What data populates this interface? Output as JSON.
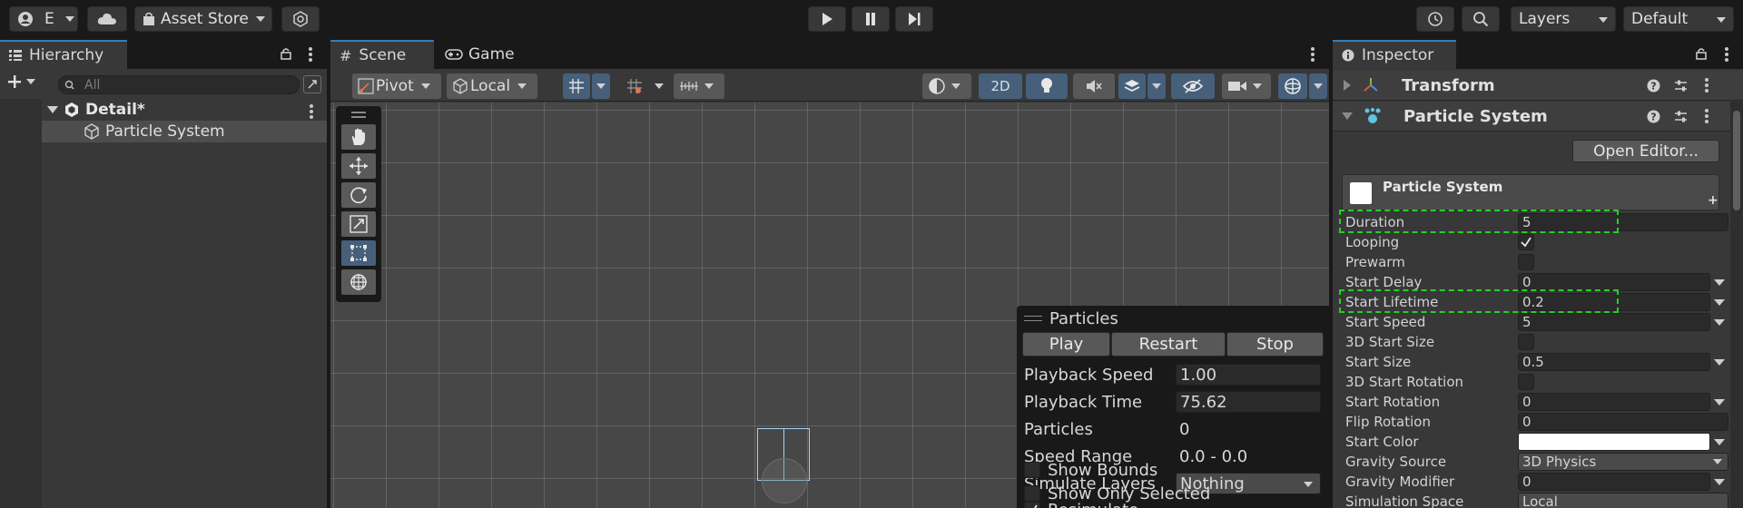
{
  "topbar": {
    "account_initial": "E",
    "asset_store": "Asset Store",
    "layers": "Layers",
    "layout": "Default"
  },
  "hierarchy": {
    "tab": "Hierarchy",
    "search_placeholder": "All",
    "scene_name": "Detail*",
    "items": [
      {
        "label": "Particle System"
      }
    ]
  },
  "scene": {
    "tabs": [
      {
        "label": "Scene"
      },
      {
        "label": "Game"
      }
    ],
    "toolbar": {
      "pivot": "Pivot",
      "local": "Local",
      "mode_2d": "2D"
    }
  },
  "particles_overlay": {
    "title": "Particles",
    "buttons": [
      "Play",
      "Restart",
      "Stop"
    ],
    "fields": [
      {
        "label": "Playback Speed",
        "value": "1.00"
      },
      {
        "label": "Playback Time",
        "value": "75.62"
      },
      {
        "label": "Particles",
        "value": "0"
      },
      {
        "label": "Speed Range",
        "value": "0.0 - 0.0"
      },
      {
        "label": "Simulate Layers",
        "value": "Nothing"
      }
    ],
    "toggles": [
      {
        "label": "Resimulate",
        "checked": true
      },
      {
        "label": "Show Bounds",
        "checked": false
      },
      {
        "label": "Show Only Selected",
        "checked": false
      }
    ]
  },
  "inspector": {
    "tab": "Inspector",
    "components": [
      {
        "name": "Transform"
      },
      {
        "name": "Particle System"
      }
    ],
    "open_editor": "Open Editor...",
    "module_title": "Particle System",
    "rows": [
      {
        "label": "Duration",
        "value": "5",
        "type": "field"
      },
      {
        "label": "Looping",
        "checked": true,
        "type": "check"
      },
      {
        "label": "Prewarm",
        "checked": false,
        "type": "check"
      },
      {
        "label": "Start Delay",
        "value": "0",
        "type": "field-dd"
      },
      {
        "label": "Start Lifetime",
        "value": "0.2",
        "type": "field-dd"
      },
      {
        "label": "Start Speed",
        "value": "5",
        "type": "field-dd"
      },
      {
        "label": "3D Start Size",
        "checked": false,
        "type": "check"
      },
      {
        "label": "Start Size",
        "value": "0.5",
        "type": "field-dd"
      },
      {
        "label": "3D Start Rotation",
        "checked": false,
        "type": "check"
      },
      {
        "label": "Start Rotation",
        "value": "0",
        "type": "field-dd"
      },
      {
        "label": "Flip Rotation",
        "value": "0",
        "type": "field"
      },
      {
        "label": "Start Color",
        "value": "",
        "type": "color"
      },
      {
        "label": "Gravity Source",
        "value": "3D Physics",
        "type": "select"
      },
      {
        "label": "Gravity Modifier",
        "value": "0",
        "type": "field-dd"
      },
      {
        "label": "Simulation Space",
        "value": "Local",
        "type": "select"
      }
    ]
  },
  "colors": {
    "accent": "#3a79bb",
    "highlight": "#25d025",
    "active_tool": "#46607c"
  }
}
